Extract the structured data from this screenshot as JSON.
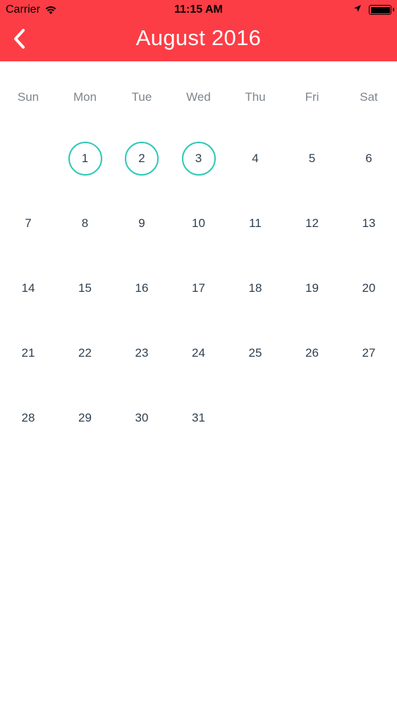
{
  "status_bar": {
    "carrier": "Carrier",
    "time": "11:15 AM",
    "icons": [
      "wifi-icon",
      "location-arrow-icon",
      "battery-icon"
    ]
  },
  "nav": {
    "back_icon": "chevron-left-icon",
    "title": "August 2016"
  },
  "calendar": {
    "weekdays": [
      "Sun",
      "Mon",
      "Tue",
      "Wed",
      "Thu",
      "Fri",
      "Sat"
    ],
    "first_weekday_index": 1,
    "days_in_month": 31,
    "selected_days": [
      1,
      2,
      3
    ]
  },
  "colors": {
    "header": "#fc3d45",
    "selected_ring": "#2ec9b6",
    "day_text": "#2e3f4f",
    "weekday_text": "#7d858c"
  }
}
